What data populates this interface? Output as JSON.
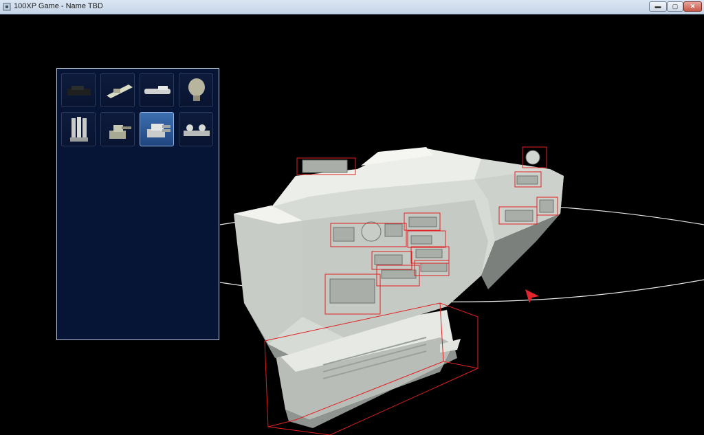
{
  "window": {
    "title": "100XP Game - Name TBD",
    "controls": {
      "minimize": "▬",
      "maximize": "▢",
      "close": "✕"
    }
  },
  "colors": {
    "background": "#000000",
    "panel_bg": "#061435",
    "slot_selected": "#2c5a98",
    "selection_box": "#e02020",
    "hull": "#d9ddd8"
  },
  "inventory": {
    "slots": [
      {
        "icon": "dark-cannon-icon",
        "selected": false
      },
      {
        "icon": "railgun-icon",
        "selected": false
      },
      {
        "icon": "laser-barrel-icon",
        "selected": false
      },
      {
        "icon": "radar-dish-icon",
        "selected": false
      },
      {
        "icon": "missile-pod-icon",
        "selected": false
      },
      {
        "icon": "gun-turret-icon",
        "selected": false
      },
      {
        "icon": "heavy-turret-icon",
        "selected": true
      },
      {
        "icon": "twin-turret-icon",
        "selected": false
      }
    ]
  },
  "scene": {
    "object": "spaceship-hull",
    "orbit_path": true,
    "attached_parts_highlighted": true
  }
}
